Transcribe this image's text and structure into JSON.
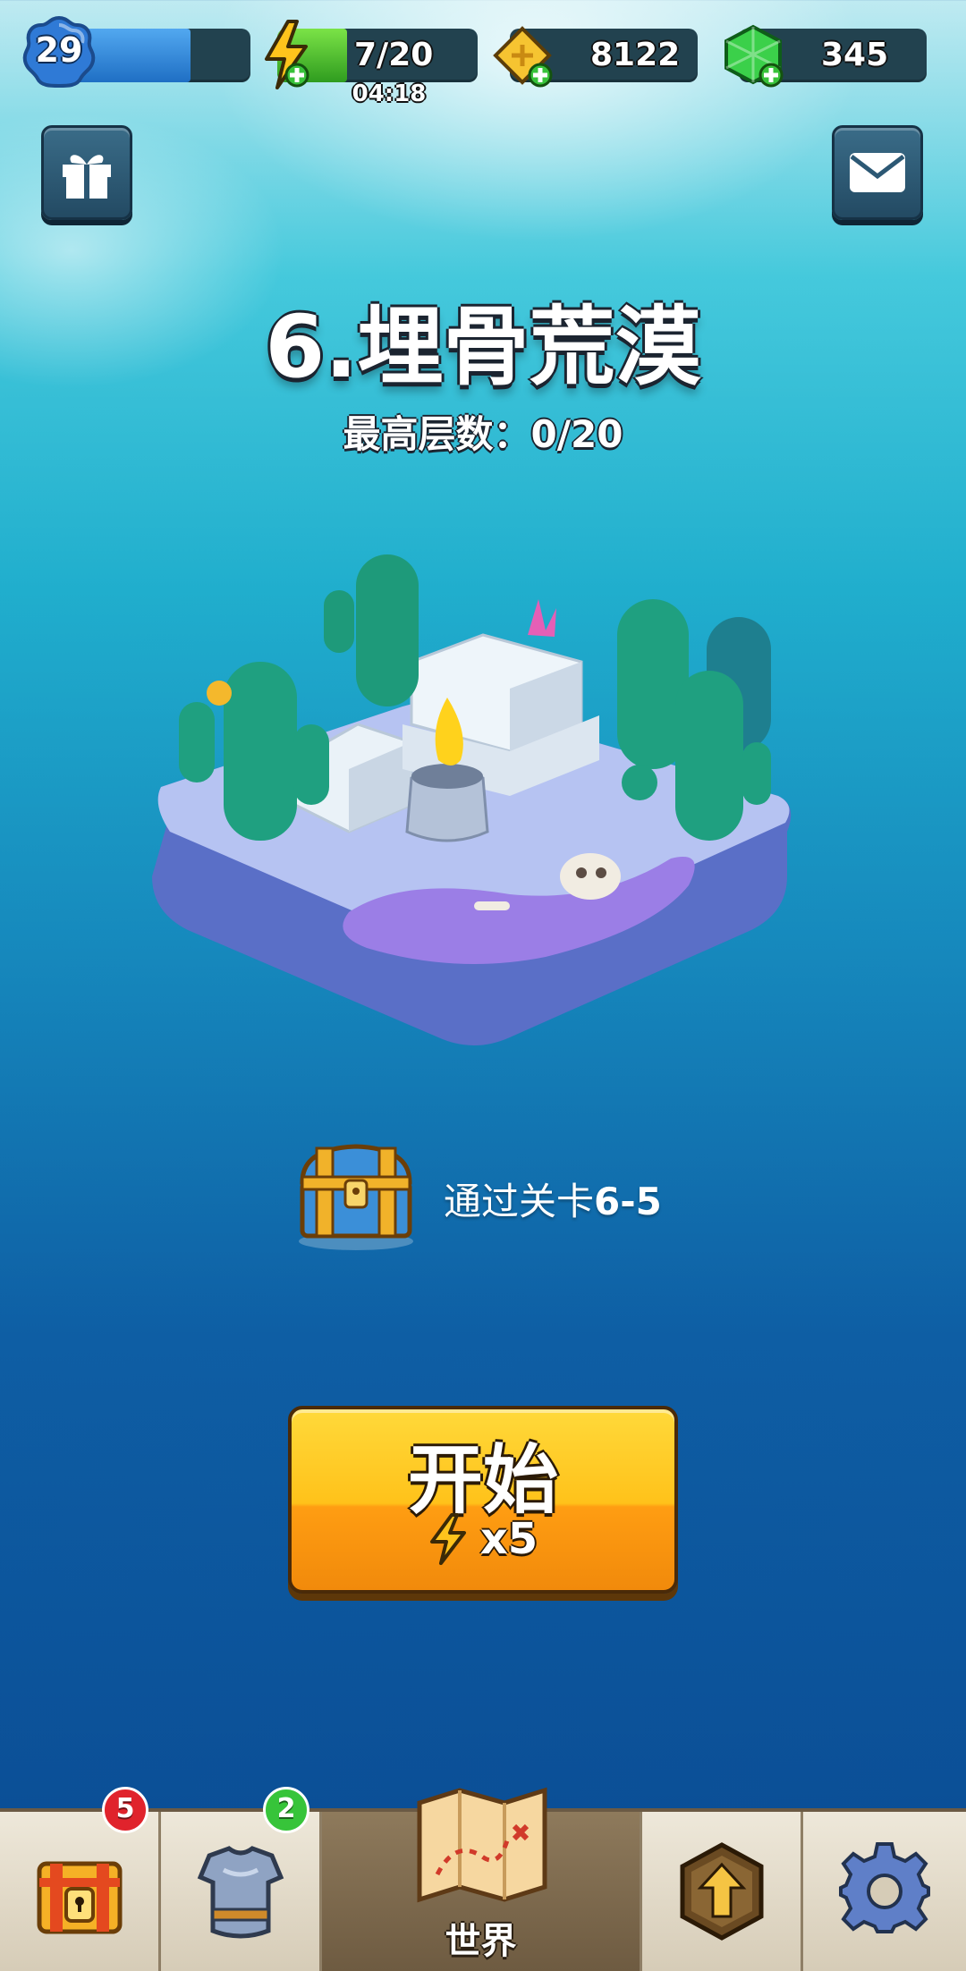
{
  "hud": {
    "level": "29",
    "xp_progress": 0.68,
    "energy": {
      "text": "7/20",
      "progress": 0.35,
      "timer": "04:18"
    },
    "coins": "8122",
    "gems": "345"
  },
  "stage": {
    "title": "6.埋骨荒漠",
    "max_floor": "最高层数：0/20"
  },
  "reward": {
    "text": "通过关卡",
    "stage": "6-5"
  },
  "start_button": {
    "label": "开始",
    "cost": "x5"
  },
  "nav": {
    "chests_badge": "5",
    "equipment_badge": "2",
    "world_label": "世界"
  },
  "colors": {
    "badge_red": "#e0232c",
    "badge_green": "#37c43a",
    "button_yellow": "#ffc21a"
  }
}
